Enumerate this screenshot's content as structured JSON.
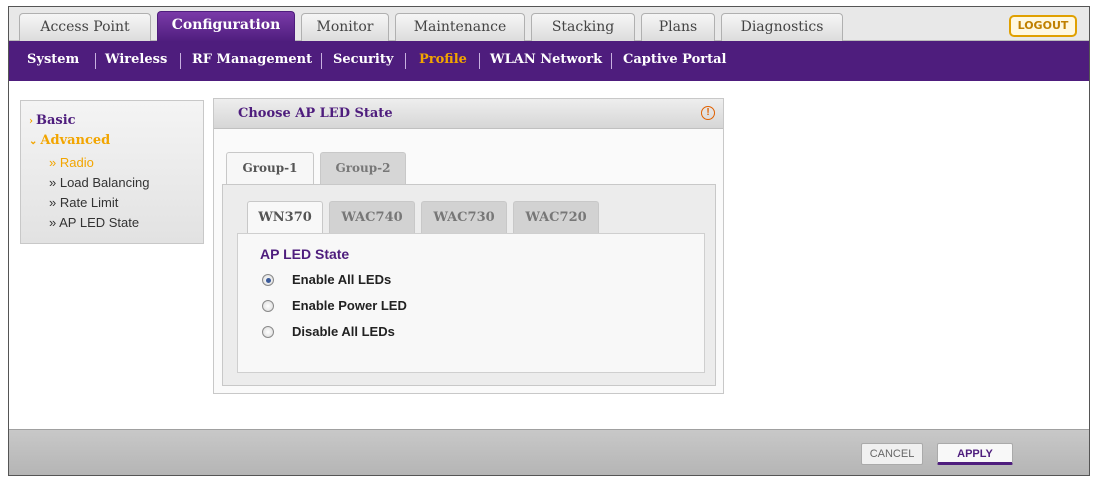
{
  "top_tabs": [
    {
      "label": "Access Point",
      "active": false
    },
    {
      "label": "Configuration",
      "active": true
    },
    {
      "label": "Monitor",
      "active": false
    },
    {
      "label": "Maintenance",
      "active": false
    },
    {
      "label": "Stacking",
      "active": false
    },
    {
      "label": "Plans",
      "active": false
    },
    {
      "label": "Diagnostics",
      "active": false
    }
  ],
  "logout_label": "LOGOUT",
  "sub_nav": [
    {
      "label": "System",
      "current": false
    },
    {
      "label": "Wireless",
      "current": false
    },
    {
      "label": "RF Management",
      "current": false
    },
    {
      "label": "Security",
      "current": false
    },
    {
      "label": "Profile",
      "current": true
    },
    {
      "label": "WLAN Network",
      "current": false
    },
    {
      "label": "Captive Portal",
      "current": false
    }
  ],
  "left_nav": {
    "basic": "Basic",
    "advanced": "Advanced",
    "items": [
      {
        "label": "» Radio",
        "selected": true
      },
      {
        "label": "» Load Balancing",
        "selected": false
      },
      {
        "label": "» Rate Limit",
        "selected": false
      },
      {
        "label": "» AP LED State",
        "selected": false
      }
    ]
  },
  "panel": {
    "title": "Choose AP LED State",
    "help_icon": "!",
    "group_tabs": [
      {
        "label": "Group-1",
        "active": true
      },
      {
        "label": "Group-2",
        "active": false
      }
    ],
    "model_tabs": [
      {
        "label": "WN370",
        "active": true
      },
      {
        "label": "WAC740",
        "active": false
      },
      {
        "label": "WAC730",
        "active": false
      },
      {
        "label": "WAC720",
        "active": false
      }
    ],
    "section_title": "AP LED State",
    "options": [
      {
        "label": "Enable All LEDs",
        "checked": true
      },
      {
        "label": "Enable Power LED",
        "checked": false
      },
      {
        "label": "Disable All LEDs",
        "checked": false
      }
    ]
  },
  "footer": {
    "cancel_label": "CANCEL",
    "apply_label": "APPLY"
  },
  "colors": {
    "brand_purple": "#4e1d7d",
    "accent_orange": "#f2a500"
  }
}
